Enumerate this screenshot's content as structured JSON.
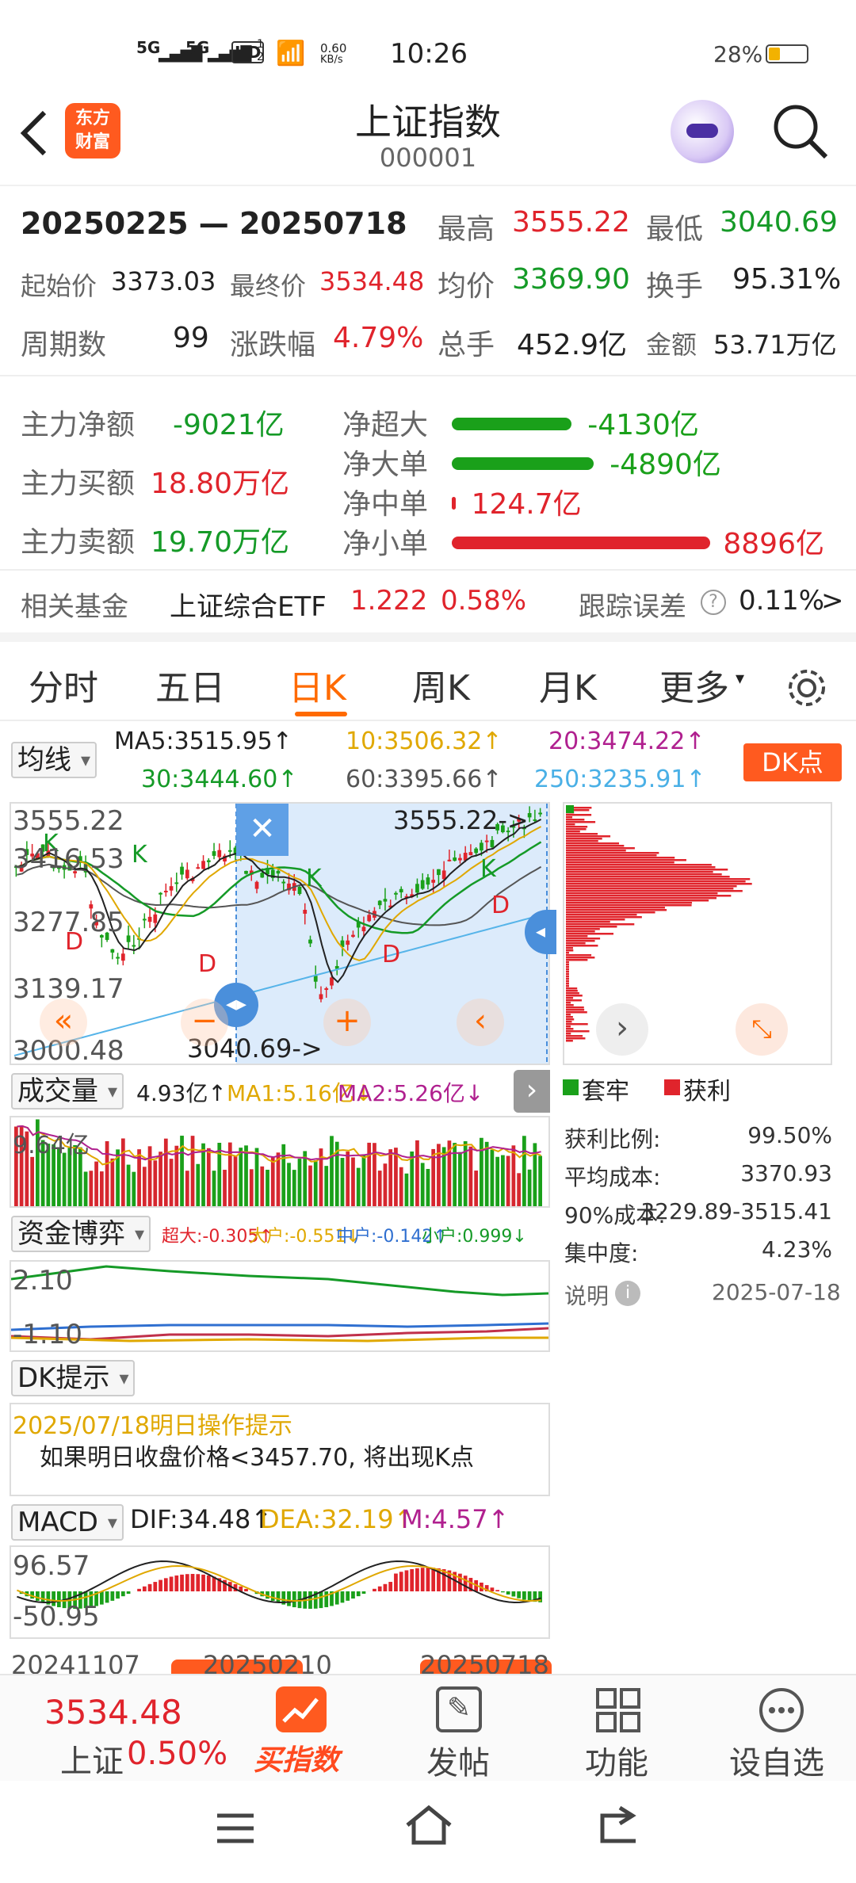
{
  "status": {
    "signal1": "5G",
    "signal2": "5G",
    "hd": "HD",
    "hd_sub": "1",
    "hd_sub2": "2",
    "speed_value": "0.60",
    "speed_unit": "KB/s",
    "time": "10:26",
    "battery": "28%"
  },
  "header": {
    "logo_line1": "东方",
    "logo_line2": "财富",
    "title": "上证指数",
    "code": "000001"
  },
  "summary": {
    "range": "20250225 — 20250718",
    "high_label": "最高",
    "high": "3555.22",
    "low_label": "最低",
    "low": "3040.69",
    "start_label": "起始价",
    "start": "3373.03",
    "end_label": "最终价",
    "end": "3534.48",
    "avg_label": "均价",
    "avg": "3369.90",
    "turnover_label": "换手",
    "turnover": "95.31%",
    "periods_label": "周期数",
    "periods": "99",
    "change_label": "涨跌幅",
    "change": "4.79%",
    "volume_label": "总手",
    "volume": "452.9亿",
    "amount_label": "金额",
    "amount": "53.71万亿"
  },
  "flow": {
    "net_label": "主力净额",
    "net": "-9021亿",
    "buy_label": "主力买额",
    "buy": "18.80万亿",
    "sell_label": "主力卖额",
    "sell": "19.70万亿",
    "rows": [
      {
        "label": "净超大",
        "value": "-4130亿",
        "ratio": -0.464,
        "color": "#1aa01a"
      },
      {
        "label": "净大单",
        "value": "-4890亿",
        "ratio": -0.55,
        "color": "#1aa01a"
      },
      {
        "label": "净中单",
        "value": "124.7亿",
        "ratio": 0.014,
        "color": "#e0242c"
      },
      {
        "label": "净小单",
        "value": "8896亿",
        "ratio": 1.0,
        "color": "#e0242c"
      }
    ]
  },
  "fund": {
    "label": "相关基金",
    "name": "上证综合ETF",
    "price": "1.222",
    "pct": "0.58%",
    "track_label": "跟踪误差",
    "track": "0.11%",
    "arrow": ">"
  },
  "tabs": [
    "分时",
    "五日",
    "日K",
    "周K",
    "月K",
    "更多"
  ],
  "active_tab": "日K",
  "ma": {
    "selector": "均线",
    "ma5": "MA5:3515.95↑",
    "ma10": "10:3506.32↑",
    "ma20": "20:3474.22↑",
    "ma30": "30:3444.60↑",
    "ma60": "60:3395.66↑",
    "ma250": "250:3235.91↑",
    "dk": "DK点"
  },
  "kline": {
    "y1": "3555.22",
    "y2": "3416.53",
    "y3": "3277.85",
    "y4": "3139.17",
    "y5": "3000.48",
    "hi_ann": "3555.22->",
    "lo_ann": "3040.69->"
  },
  "volume": {
    "selector": "成交量",
    "value": "4.93亿↑",
    "ma1": "MA1:5.16亿↓",
    "ma2": "MA2:5.26亿↓",
    "axis": "9.64亿"
  },
  "capital": {
    "selector": "资金博弈",
    "super": "超大:-0.305↑",
    "big": "大户:-0.551↓",
    "mid": "中户:-0.142↑",
    "small": "小户:0.999↓",
    "y1": "2.10",
    "y2": "-1.10"
  },
  "dk": {
    "selector": "DK提示",
    "date_line": "2025/07/18明日操作提示",
    "msg": "如果明日收盘价格<3457.70, 将出现K点"
  },
  "macd": {
    "selector": "MACD",
    "dif": "DIF:34.48↑",
    "dea": "DEA:32.19↑",
    "m": "M:4.57↑",
    "y1": "96.57",
    "y2": "-50.95",
    "d1": "20241107",
    "d2": "20250210",
    "d3": "20250718"
  },
  "chip": {
    "legend_trap": "套牢",
    "legend_profit": "获利",
    "rows": [
      [
        "获利比例:",
        "99.50%"
      ],
      [
        "平均成本:",
        "3370.93"
      ],
      [
        "90%成本:",
        "3229.89-3515.41"
      ],
      [
        "集中度:",
        "4.23%"
      ]
    ],
    "note": "说明",
    "date": "2025-07-18"
  },
  "bottom": {
    "price": "3534.48",
    "name": "上证",
    "pct": "0.50%",
    "buy": "买指数",
    "post": "发帖",
    "func": "功能",
    "watch": "设自选"
  }
}
